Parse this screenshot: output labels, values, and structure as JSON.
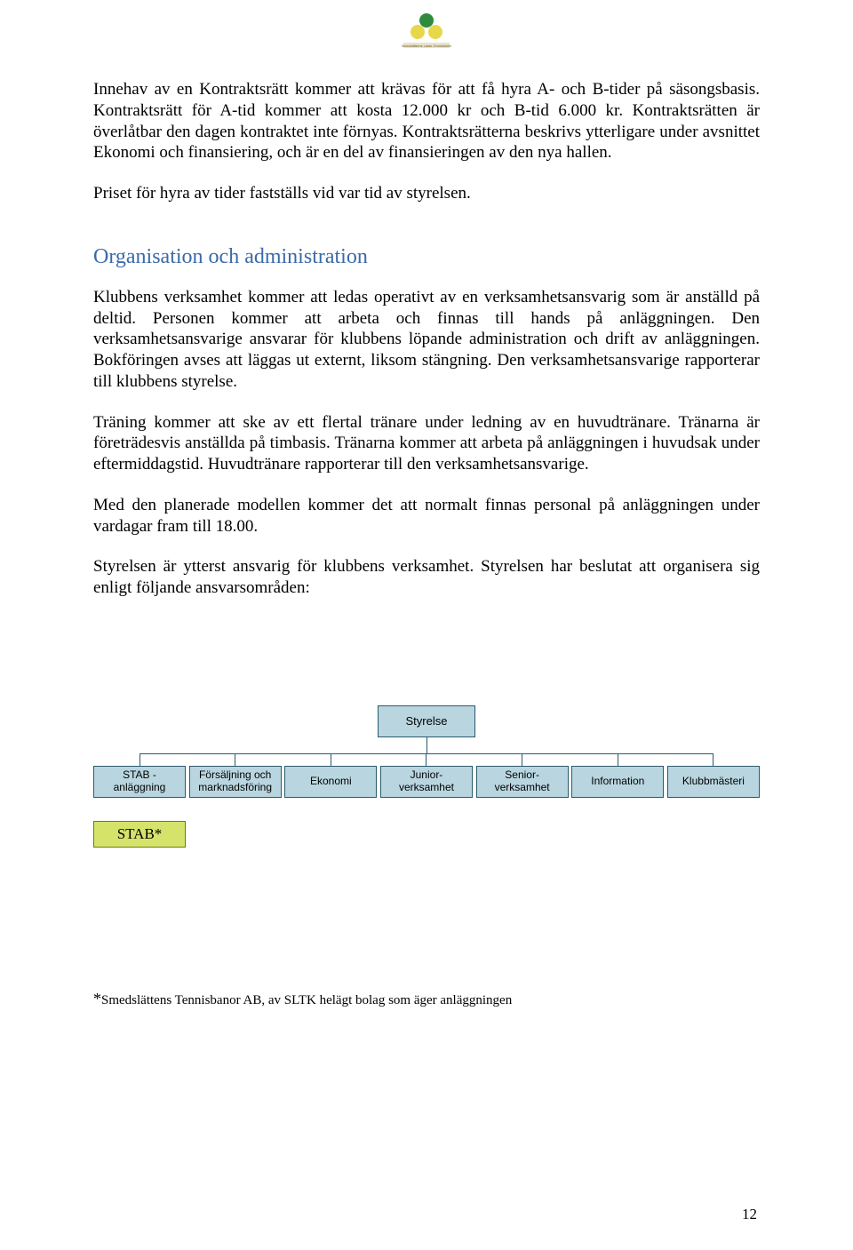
{
  "logo_caption": "Smedslättens Lawn-Tennisklubb",
  "body": {
    "p1": "Innehav av en Kontraktsrätt kommer att krävas för att få hyra A- och B-tider på säsongsbasis. Kontraktsrätt för A-tid kommer att kosta 12.000 kr och B-tid 6.000 kr. Kontraktsrätten är överlåtbar den dagen kontraktet inte förnyas. Kontraktsrätterna beskrivs ytterligare under avsnittet Ekonomi och finansiering, och är en del av finansieringen av den nya hallen.",
    "p2": "Priset för hyra av tider fastställs vid var tid av styrelsen.",
    "heading": "Organisation och administration",
    "p3": "Klubbens verksamhet kommer att ledas operativt av en verksamhetsansvarig som är anställd på deltid. Personen kommer att arbeta och finnas till hands på anläggningen. Den verksamhetsansvarige ansvarar för klubbens löpande administration och drift av anläggningen. Bokföringen avses att läggas ut externt, liksom stängning. Den verksamhetsansvarige rapporterar till klubbens styrelse.",
    "p4": "Träning kommer att ske av ett flertal tränare under ledning av en huvudtränare. Tränarna är företrädesvis anställda på timbasis. Tränarna kommer att arbeta på anläggningen i huvudsak under eftermiddagstid. Huvudtränare rapporterar till den verksamhetsansvarige.",
    "p5": "Med den planerade modellen kommer det att normalt finnas personal på anläggningen under vardagar fram till 18.00.",
    "p6": "Styrelsen är ytterst ansvarig för klubbens verksamhet. Styrelsen har beslutat att organisera sig enligt följande ansvarsområden:"
  },
  "orgchart": {
    "top": "Styrelse",
    "children": [
      "STAB - anläggning",
      "Försäljning och marknadsföring",
      "Ekonomi",
      "Junior-\nverksamhet",
      "Senior-\nverksamhet",
      "Information",
      "Klubbmästeri"
    ],
    "extra_box": "STAB*"
  },
  "footnote": "Smedslättens Tennisbanor AB, av SLTK helägt bolag som äger anläggningen",
  "page_number": "12"
}
